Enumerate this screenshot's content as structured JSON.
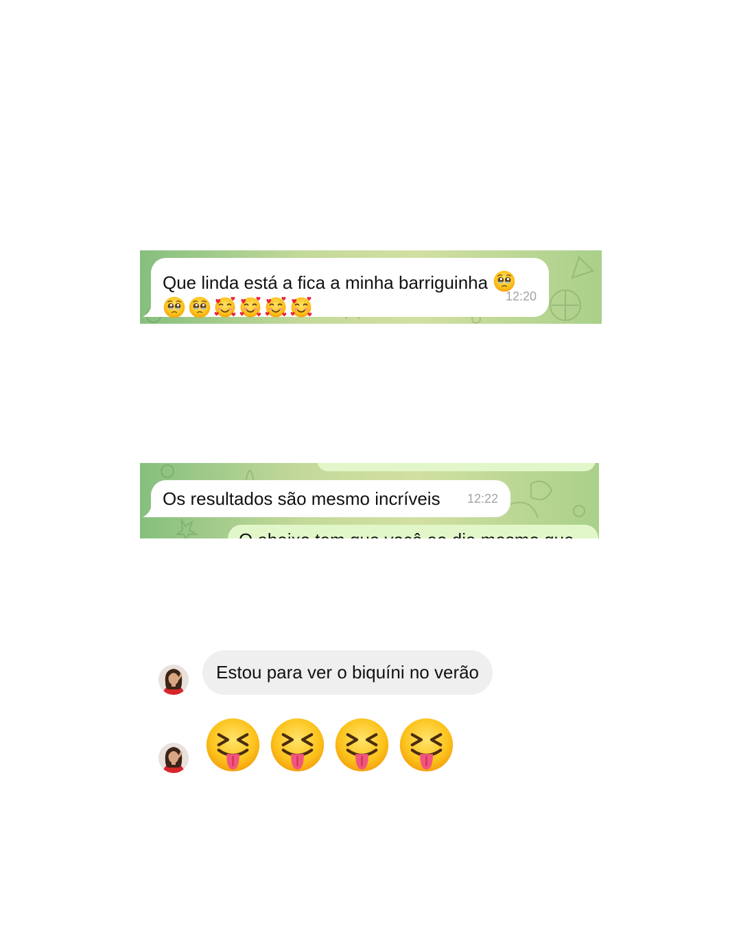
{
  "telegram_chat_1": {
    "message_line1": "Que linda está a fica a minha barriguinha",
    "time": "12:20",
    "emojis_line1": [
      "pleading-face"
    ],
    "emojis_line2": [
      "pleading-face",
      "pleading-face",
      "smiling-face-with-hearts",
      "smiling-face-with-hearts",
      "smiling-face-with-hearts",
      "smiling-face-with-hearts"
    ]
  },
  "telegram_chat_2": {
    "message": "Os resultados são mesmo incríveis",
    "time": "12:22",
    "partial_sent_text": "O abaixo tem que você ao dia mesmo que"
  },
  "instagram_chat": {
    "message": "Estou para ver o biquíni no verão",
    "emoji_reaction": [
      "squinting-face-with-tongue",
      "squinting-face-with-tongue",
      "squinting-face-with-tongue",
      "squinting-face-with-tongue"
    ]
  },
  "colors": {
    "telegram_green_dark": "#86bf7e",
    "telegram_green_light": "#d2e0a2",
    "sent_bubble": "#e1f7c9",
    "ig_bubble": "#efefef",
    "time_gray": "#a3a3a3"
  }
}
